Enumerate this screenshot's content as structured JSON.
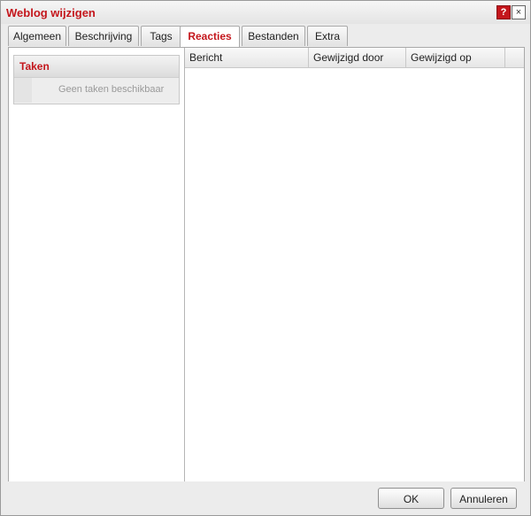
{
  "window": {
    "title": "Weblog wijzigen",
    "help_icon": "?",
    "close_icon": "×"
  },
  "tabs": [
    {
      "label": "Algemeen"
    },
    {
      "label": "Beschrijving"
    },
    {
      "label": "Tags"
    },
    {
      "label": "Reacties",
      "active": true
    },
    {
      "label": "Bestanden"
    },
    {
      "label": "Extra"
    }
  ],
  "tasks": {
    "header": "Taken",
    "empty_text": "Geen taken beschikbaar"
  },
  "grid": {
    "columns": [
      "Bericht",
      "Gewijzigd door",
      "Gewijzigd op"
    ]
  },
  "footer": {
    "ok_label": "OK",
    "cancel_label": "Annuleren"
  },
  "colors": {
    "accent": "#c4161c"
  }
}
